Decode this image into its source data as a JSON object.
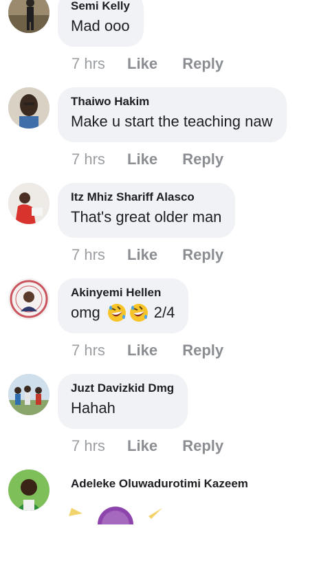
{
  "comments": [
    {
      "author": "Semi Kelly",
      "text": "Mad ooo",
      "time": "7 hrs",
      "like": "Like",
      "reply": "Reply"
    },
    {
      "author": "Thaiwo Hakim",
      "text": "Make u start the teaching naw",
      "time": "7 hrs",
      "like": "Like",
      "reply": "Reply"
    },
    {
      "author": "Itz Mhiz Shariff Alasco",
      "text": "That's great older man",
      "time": "7 hrs",
      "like": "Like",
      "reply": "Reply"
    },
    {
      "author": "Akinyemi Hellen",
      "text": "omg",
      "text_suffix": "2/4",
      "emojis": [
        "rolling-on-floor-laughing-emoji",
        "rolling-on-floor-laughing-emoji"
      ],
      "time": "7 hrs",
      "like": "Like",
      "reply": "Reply"
    },
    {
      "author": "Juzt Davizkid Dmg",
      "text": "Hahah",
      "time": "7 hrs",
      "like": "Like",
      "reply": "Reply"
    },
    {
      "author": "Adeleke Oluwadurotimi Kazeem"
    }
  ],
  "colors": {
    "bubble": "#f0f2f5",
    "meta": "#8a8d91",
    "text": "#1c1e21"
  }
}
